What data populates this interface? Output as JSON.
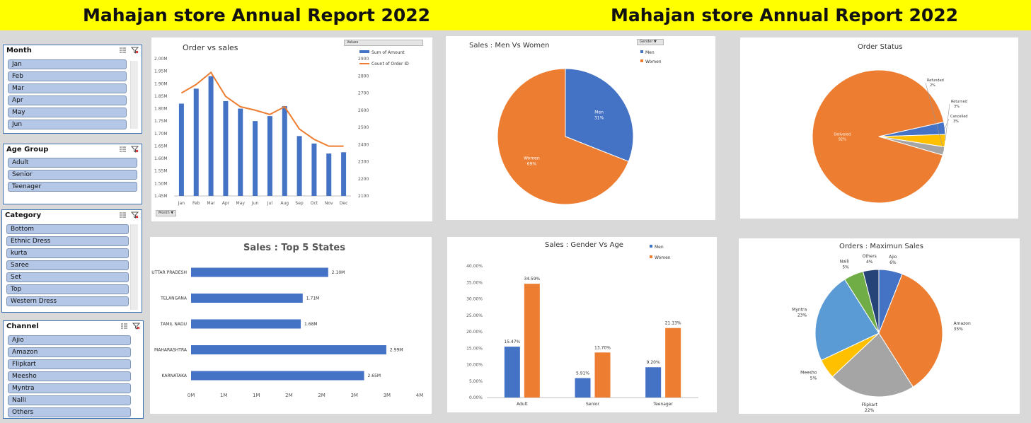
{
  "banner": {
    "title_left": "Mahajan store Annual Report 2022",
    "title_right": "Mahajan store Annual Report 2022",
    "bg_color": "#ffff00"
  },
  "colors": {
    "blue": "#4472c4",
    "orange": "#ed7d31",
    "gray": "#a5a5a5",
    "yellow": "#ffc000",
    "lightblue": "#5b9bd5",
    "green": "#70ad47",
    "navy": "#264478",
    "slicer_item": "#b4c7e7",
    "slicer_border": "#3b6fb3"
  },
  "slicers": {
    "month": {
      "title": "Month",
      "items": [
        "Jan",
        "Feb",
        "Mar",
        "Apr",
        "May",
        "Jun"
      ]
    },
    "age_group": {
      "title": "Age Group",
      "items": [
        "Adult",
        "Senior",
        "Teenager"
      ]
    },
    "category": {
      "title": "Category",
      "items": [
        "Bottom",
        "Ethnic Dress",
        "kurta",
        "Saree",
        "Set",
        "Top",
        "Western Dress"
      ]
    },
    "channel": {
      "title": "Channel",
      "items": [
        "Ajio",
        "Amazon",
        "Flipkart",
        "Meesho",
        "Myntra",
        "Nalli",
        "Others"
      ]
    }
  },
  "chart_data": [
    {
      "type": "bar",
      "title": "Order vs sales",
      "categories": [
        "Jan",
        "Feb",
        "Mar",
        "Apr",
        "May",
        "Jun",
        "Jul",
        "Aug",
        "Sep",
        "Oct",
        "Nov",
        "Dec"
      ],
      "series": [
        {
          "name": "Sum of Amount",
          "kind": "bar",
          "axis": "left",
          "values": [
            1.82,
            1.88,
            1.93,
            1.83,
            1.8,
            1.75,
            1.77,
            1.81,
            1.69,
            1.66,
            1.62,
            1.625
          ]
        },
        {
          "name": "Count of Order ID",
          "kind": "line",
          "axis": "right",
          "values": [
            2700,
            2750,
            2820,
            2680,
            2620,
            2600,
            2575,
            2620,
            2490,
            2430,
            2390,
            2390
          ]
        }
      ],
      "ylim": [
        1.45,
        2.0
      ],
      "ylim_right": [
        2100,
        2900
      ],
      "y_ticks": [
        "1.45M",
        "1.50M",
        "1.55M",
        "1.60M",
        "1.65M",
        "1.70M",
        "1.75M",
        "1.80M",
        "1.85M",
        "1.90M",
        "1.95M",
        "2.00M"
      ],
      "y_right_ticks": [
        "2100",
        "2200",
        "2300",
        "2400",
        "2500",
        "2600",
        "2700",
        "2800",
        "2900"
      ],
      "legend_header": "Values",
      "field_button": "Month",
      "legend": "top-right",
      "grid": false
    },
    {
      "type": "bar",
      "orientation": "horizontal",
      "title": "Sales : Top 5 States",
      "categories": [
        "UTTAR PRADESH",
        "TELANGANA",
        "TAMIL NADU",
        "MAHARASHTRA",
        "KARNATAKA"
      ],
      "values": [
        2.1,
        1.71,
        1.68,
        2.99,
        2.65
      ],
      "data_labels": [
        "2.10M",
        "1.71M",
        "1.68M",
        "2.99M",
        "2.65M"
      ],
      "x_ticks": [
        "0M",
        "1M",
        "1M",
        "2M",
        "2M",
        "3M",
        "3M",
        "4M"
      ],
      "xlim": [
        0,
        3.5
      ],
      "grid": false
    },
    {
      "type": "pie",
      "title": "Sales : Men Vs Women",
      "categories": [
        "Men",
        "Women"
      ],
      "values": [
        31,
        69
      ],
      "data_labels": [
        [
          "Men",
          "31%"
        ],
        [
          "Women",
          "69%"
        ]
      ],
      "field_button": "Gender",
      "legend": "top-right"
    },
    {
      "type": "bar",
      "title": "Sales : Gender Vs Age",
      "categories": [
        "Adult",
        "Senior",
        "Teenager"
      ],
      "series": [
        {
          "name": "Men",
          "values": [
            15.47,
            5.91,
            9.2
          ],
          "labels": [
            "15.47%",
            "5.91%",
            "9.20%"
          ]
        },
        {
          "name": "Women",
          "values": [
            34.59,
            13.7,
            21.13
          ],
          "labels": [
            "34.59%",
            "13.70%",
            "21.13%"
          ]
        }
      ],
      "ylim": [
        0,
        40
      ],
      "y_ticks": [
        "0.00%",
        "5.00%",
        "10.00%",
        "15.00%",
        "20.00%",
        "25.00%",
        "30.00%",
        "35.00%",
        "40.00%"
      ],
      "legend": "top-right",
      "grid": false
    },
    {
      "type": "pie",
      "title": "Order Status",
      "categories": [
        "Delivered",
        "Cancelled",
        "Returned",
        "Refunded"
      ],
      "values": [
        92,
        3,
        3,
        2
      ],
      "data_labels": [
        [
          "Delivered",
          "92%"
        ],
        [
          "Cancelled",
          "3%"
        ],
        [
          "Returned",
          "3%"
        ],
        [
          "Refunded",
          "2%"
        ]
      ]
    },
    {
      "type": "pie",
      "title": "Orders : Maximun Sales",
      "categories": [
        "Ajio",
        "Amazon",
        "Flipkart",
        "Meesho",
        "Myntra",
        "Nalli",
        "Others"
      ],
      "values": [
        6,
        35,
        22,
        5,
        23,
        5,
        4
      ],
      "data_labels": [
        [
          "Ajio",
          "6%"
        ],
        [
          "Amazon",
          "35%"
        ],
        [
          "Flipkart",
          "22%"
        ],
        [
          "Meesho",
          "5%"
        ],
        [
          "Myntra",
          "23%"
        ],
        [
          "Nalli",
          "5%"
        ],
        [
          "Others",
          "4%"
        ]
      ]
    }
  ]
}
